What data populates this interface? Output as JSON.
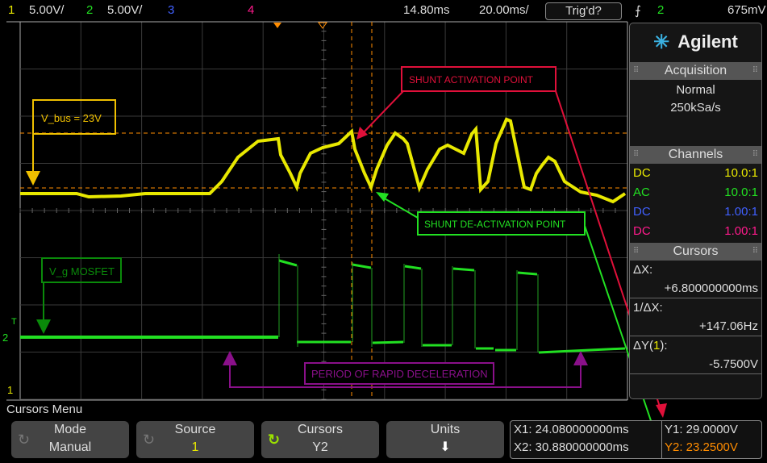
{
  "topbar": {
    "ch1_num": "1",
    "ch1_scale": "5.00V/",
    "ch2_num": "2",
    "ch2_scale": "5.00V/",
    "ch3_num": "3",
    "ch4_num": "4",
    "delay": "14.80ms",
    "timebase": "20.00ms/",
    "trigger_status": "Trig'd?",
    "trigger_source": "2",
    "trigger_level": "675mV"
  },
  "colors": {
    "ch1": "#e8e800",
    "ch2": "#22e022",
    "ch3": "#4060ff",
    "ch4": "#ff1a8c",
    "cursor": "#ff8c00"
  },
  "annotations": {
    "vbus": "V_bus = 23V",
    "vg": "V_g MOSFET",
    "shunt_on": "SHUNT ACTIVATION POINT",
    "shunt_off": "SHUNT DE-ACTIVATION POINT",
    "decel": "PERIOD OF RAPID DECELERATION"
  },
  "markers": {
    "ch2": "2",
    "ch1": "1",
    "trig": "T"
  },
  "side": {
    "brand": "Agilent",
    "acq_title": "Acquisition",
    "acq_mode": "Normal",
    "acq_rate": "250kSa/s",
    "channels_title": "Channels",
    "channels": [
      {
        "coupling": "DC",
        "probe": "10.0:1",
        "color": "#e8e800"
      },
      {
        "coupling": "AC",
        "probe": "10.0:1",
        "color": "#22e022"
      },
      {
        "coupling": "DC",
        "probe": "1.00:1",
        "color": "#4060ff"
      },
      {
        "coupling": "DC",
        "probe": "1.00:1",
        "color": "#ff1a8c"
      }
    ],
    "cursors_title": "Cursors",
    "dx_label": "ΔX:",
    "dx": "+6.800000000ms",
    "inv_dx_label": "1/ΔX:",
    "inv_dx": "+147.06Hz",
    "dy_label_pre": "ΔY(",
    "dy_label_ch": "1",
    "dy_label_post": "):",
    "dy": "-5.7500V"
  },
  "menu": {
    "title": "Cursors Menu",
    "buttons": [
      {
        "label": "Mode",
        "value": "Manual"
      },
      {
        "label": "Source",
        "value": "1"
      },
      {
        "label": "Cursors",
        "value": "Y2"
      },
      {
        "label": "Units",
        "value": "⬇"
      }
    ]
  },
  "readout": {
    "x1": "X1: 24.080000000ms",
    "x2": "X2: 30.880000000ms",
    "y1": "Y1: 29.0000V",
    "y2": "Y2: 23.2500V"
  }
}
